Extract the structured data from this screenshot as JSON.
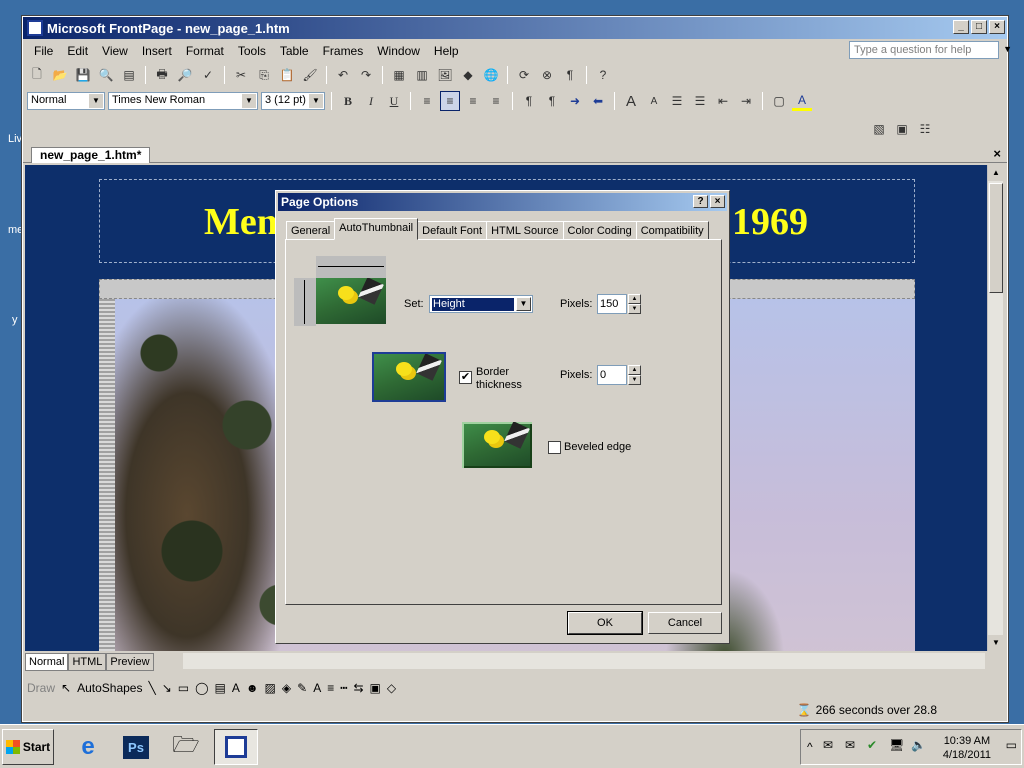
{
  "window": {
    "title": "Microsoft FrontPage - new_page_1.htm"
  },
  "menu": [
    "File",
    "Edit",
    "View",
    "Insert",
    "Format",
    "Tools",
    "Table",
    "Frames",
    "Window",
    "Help"
  ],
  "help_placeholder": "Type a question for help",
  "format_bar": {
    "style": "Normal",
    "font": "Times New Roman",
    "size": "3  (12 pt)"
  },
  "document": {
    "tab": "new_page_1.htm*",
    "heading_left": "Mem",
    "heading_right": "1969"
  },
  "view_tabs": [
    "Normal",
    "HTML",
    "Preview"
  ],
  "draw_bar": {
    "draw": "Draw",
    "autoshapes": "AutoShapes"
  },
  "status": {
    "download": "266 seconds over 28.8"
  },
  "dialog": {
    "title": "Page Options",
    "tabs": [
      "General",
      "AutoThumbnail",
      "Default Font",
      "HTML Source",
      "Color Coding",
      "Compatibility"
    ],
    "active_tab": "AutoThumbnail",
    "set_label": "Set:",
    "set_value": "Height",
    "pixels_label_1": "Pixels:",
    "pixels_value_1": "150",
    "border_label_line1": "Border",
    "border_label_line2": "thickness",
    "border_checked": true,
    "pixels_label_2": "Pixels:",
    "pixels_value_2": "0",
    "beveled_label": "Beveled edge",
    "beveled_checked": false,
    "ok": "OK",
    "cancel": "Cancel"
  },
  "taskbar": {
    "start": "Start",
    "time": "10:39 AM",
    "date": "4/18/2011"
  },
  "desktop_labels": [
    "Liv",
    "me",
    "y"
  ]
}
